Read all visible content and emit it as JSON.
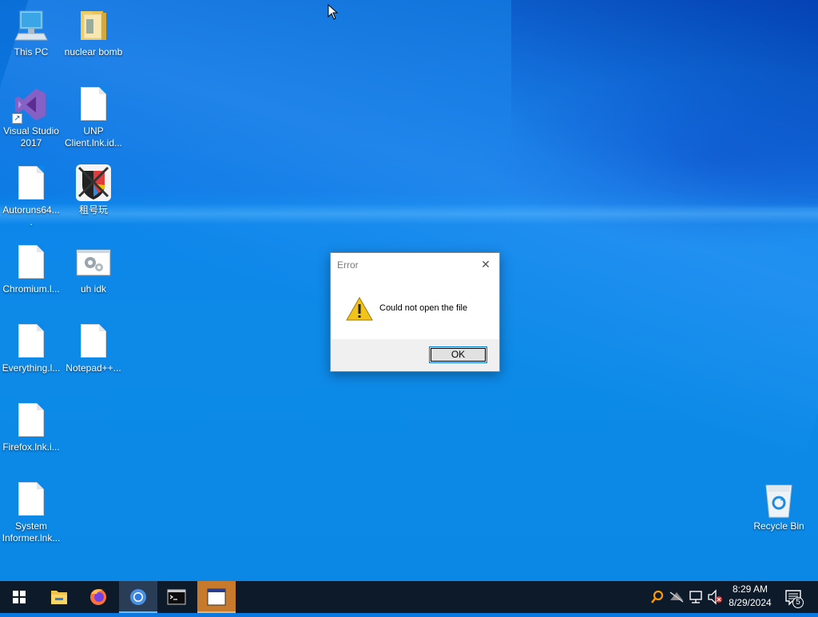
{
  "desktop_icons": [
    {
      "label": "This PC",
      "icon": "computer-icon"
    },
    {
      "label": "nuclear bomb",
      "icon": "folder-icon"
    },
    {
      "label": "Visual Studio 2017",
      "icon": "visual-studio-icon"
    },
    {
      "label": "UNP Client.lnk.id...",
      "icon": "document-icon"
    },
    {
      "label": "Autoruns64....",
      "icon": "document-icon"
    },
    {
      "label": "租号玩",
      "icon": "zuhaowan-app-icon"
    },
    {
      "label": "Chromium.l...",
      "icon": "document-icon"
    },
    {
      "label": "uh idk",
      "icon": "settings-window-icon"
    },
    {
      "label": "Everything.l...",
      "icon": "document-icon"
    },
    {
      "label": "Notepad++...",
      "icon": "document-icon"
    },
    {
      "label": "Firefox.lnk.i...",
      "icon": "document-icon"
    },
    {
      "label": "System Informer.lnk...",
      "icon": "document-icon"
    },
    {
      "label": "Recycle Bin",
      "icon": "recycle-bin-icon"
    }
  ],
  "dialog": {
    "title": "Error",
    "message": "Could not open the file",
    "ok_label": "OK",
    "close_glyph": "✕"
  },
  "taskbar": {
    "time": "8:29 AM",
    "date": "8/29/2024",
    "notification_count": "5",
    "apps": [
      "start-icon",
      "file-explorer-icon",
      "firefox-icon",
      "chromium-icon",
      "terminal-icon",
      "window-app-icon"
    ]
  },
  "colors": {
    "desktop": "#0a78e0",
    "taskbar": "#0d1a2a",
    "active_app_accent": "#76b9ed",
    "orange_app": "#c77a2b"
  }
}
